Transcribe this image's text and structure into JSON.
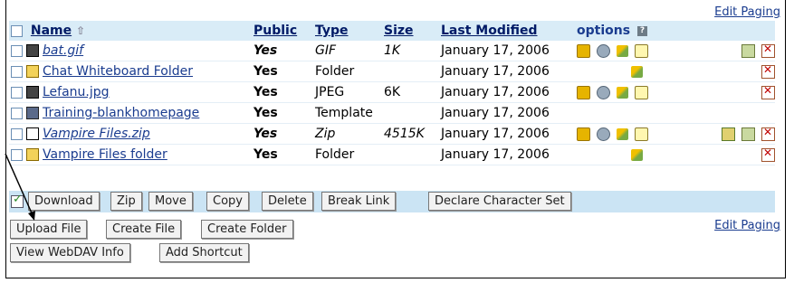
{
  "edit_paging_top": "Edit Paging",
  "edit_paging_bottom": "Edit Paging",
  "header": {
    "name": "Name",
    "sort_icon": "up-arrow-icon",
    "public": "Public",
    "type": "Type",
    "size": "Size",
    "last_modified": "Last Modified",
    "options": "options",
    "help": "?"
  },
  "rows": [
    {
      "name": "bat.gif",
      "public": "Yes",
      "type": "GIF",
      "size": "1K",
      "modified": "January 17, 2006",
      "icon": "file-icon",
      "italic": true
    },
    {
      "name": "Chat Whiteboard Folder",
      "public": "Yes",
      "type": "Folder",
      "size": "",
      "modified": "January 17, 2006",
      "icon": "folder-icon",
      "italic": false
    },
    {
      "name": "Lefanu.jpg",
      "public": "Yes",
      "type": "JPEG",
      "size": "6K",
      "modified": "January 17, 2006",
      "icon": "file-icon",
      "italic": false
    },
    {
      "name": "Training-blankhomepage",
      "public": "Yes",
      "type": "Template",
      "size": "",
      "modified": "January 17, 2006",
      "icon": "template-icon",
      "italic": false
    },
    {
      "name": "Vampire Files.zip",
      "public": "Yes",
      "type": "Zip",
      "size": "4515K",
      "modified": "January 17, 2006",
      "icon": "blank-file-icon",
      "italic": true
    },
    {
      "name": "Vampire Files folder",
      "public": "Yes",
      "type": "Folder",
      "size": "",
      "modified": "January 17, 2006",
      "icon": "folder-icon",
      "italic": false
    }
  ],
  "action_buttons": [
    "Download",
    "Zip",
    "Move",
    "Copy",
    "Delete",
    "Break Link",
    "Declare Character Set"
  ],
  "bottom_buttons_row1": [
    "Upload File",
    "Create File",
    "Create Folder"
  ],
  "bottom_buttons_row2": [
    "View WebDAV Info",
    "Add Shortcut"
  ]
}
